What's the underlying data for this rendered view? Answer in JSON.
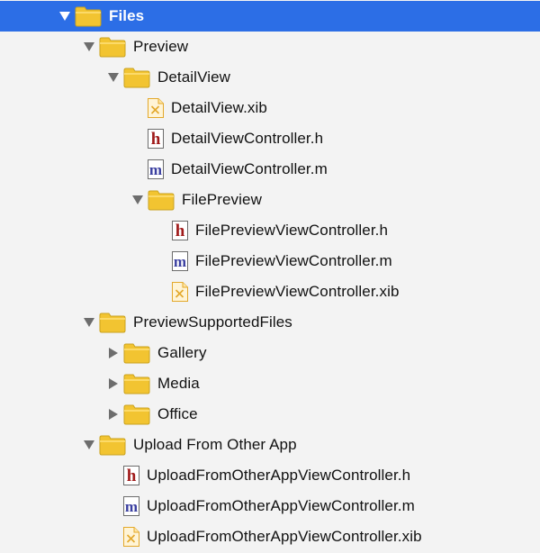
{
  "colors": {
    "selection": "#2c6ee6",
    "background": "#f3f3f3",
    "folder": "#f2c431",
    "header_file": "#a01b1b",
    "impl_file": "#3a3fa0",
    "xib_file": "#e3a82a"
  },
  "tree": [
    {
      "label": "Files",
      "depth": 0,
      "kind": "folder",
      "disclosure": "open",
      "selected": true
    },
    {
      "label": "Preview",
      "depth": 1,
      "kind": "folder",
      "disclosure": "open"
    },
    {
      "label": "DetailView",
      "depth": 2,
      "kind": "folder",
      "disclosure": "open"
    },
    {
      "label": "DetailView.xib",
      "depth": 3,
      "kind": "xib",
      "icon_glyph": ""
    },
    {
      "label": "DetailViewController.h",
      "depth": 3,
      "kind": "h",
      "icon_glyph": "h"
    },
    {
      "label": "DetailViewController.m",
      "depth": 3,
      "kind": "m",
      "icon_glyph": "m"
    },
    {
      "label": "FilePreview",
      "depth": 3,
      "kind": "folder",
      "disclosure": "open"
    },
    {
      "label": "FilePreviewViewController.h",
      "depth": 4,
      "kind": "h",
      "icon_glyph": "h"
    },
    {
      "label": "FilePreviewViewController.m",
      "depth": 4,
      "kind": "m",
      "icon_glyph": "m"
    },
    {
      "label": "FilePreviewViewController.xib",
      "depth": 4,
      "kind": "xib",
      "icon_glyph": ""
    },
    {
      "label": "PreviewSupportedFiles",
      "depth": 1,
      "kind": "folder",
      "disclosure": "open"
    },
    {
      "label": "Gallery",
      "depth": 2,
      "kind": "folder",
      "disclosure": "closed"
    },
    {
      "label": "Media",
      "depth": 2,
      "kind": "folder",
      "disclosure": "closed"
    },
    {
      "label": "Office",
      "depth": 2,
      "kind": "folder",
      "disclosure": "closed"
    },
    {
      "label": "Upload From Other App",
      "depth": 1,
      "kind": "folder",
      "disclosure": "open"
    },
    {
      "label": "UploadFromOtherAppViewController.h",
      "depth": 2,
      "kind": "h",
      "icon_glyph": "h"
    },
    {
      "label": "UploadFromOtherAppViewController.m",
      "depth": 2,
      "kind": "m",
      "icon_glyph": "m"
    },
    {
      "label": "UploadFromOtherAppViewController.xib",
      "depth": 2,
      "kind": "xib",
      "icon_glyph": ""
    }
  ]
}
